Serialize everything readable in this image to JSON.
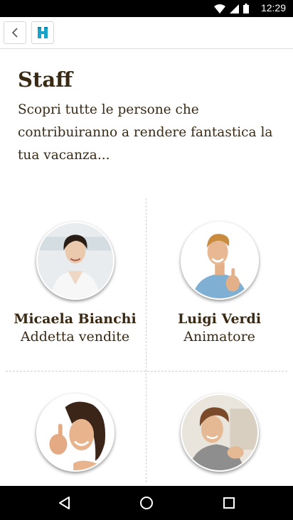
{
  "status_bar": {
    "time": "12:29"
  },
  "header": {
    "back_icon": "chevron-left-icon",
    "home_icon": "h-logo-icon",
    "accent_color": "#1aa3c8"
  },
  "page": {
    "title": "Staff",
    "intro": "Scopri tutte le persone che contribuiranno a rendere fantastica la tua vacanza..."
  },
  "staff": [
    {
      "name": "Micaela Bianchi",
      "role": "Addetta vendite"
    },
    {
      "name": "Luigi Verdi",
      "role": "Animatore"
    },
    {
      "name": "",
      "role": ""
    },
    {
      "name": "",
      "role": ""
    }
  ],
  "nav_bar": {
    "icons": [
      "back-triangle-icon",
      "home-circle-icon",
      "recents-square-icon"
    ]
  },
  "colors": {
    "text": "#3a2a14",
    "status_bar": "#000000",
    "divider": "#cfcfcf"
  }
}
